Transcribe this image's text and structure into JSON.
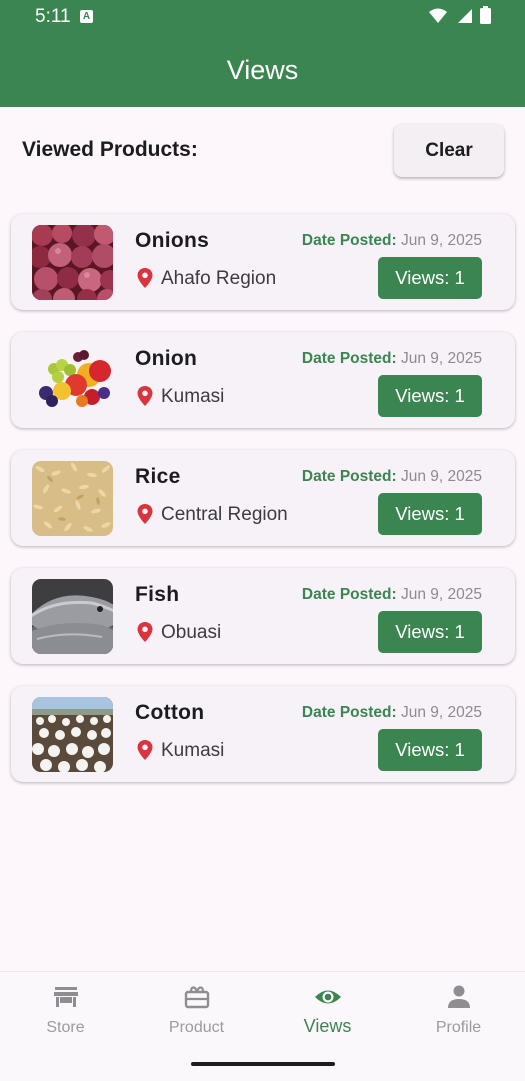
{
  "status_bar": {
    "time": "5:11",
    "notification_badge": "A",
    "icons": [
      "wifi-icon",
      "signal-icon",
      "battery-icon"
    ]
  },
  "app_bar": {
    "title": "Views",
    "color": "#3a8550"
  },
  "section": {
    "label": "Viewed Products:",
    "clear_label": "Clear"
  },
  "date_label": "Date Posted:",
  "products": [
    {
      "name": "Onions",
      "location": "Ahafo Region",
      "date": "Jun 9, 2025",
      "views": "Views: 1",
      "image": "onions"
    },
    {
      "name": "Onion",
      "location": "Kumasi",
      "date": "Jun 9, 2025",
      "views": "Views: 1",
      "image": "fruits"
    },
    {
      "name": "Rice",
      "location": "Central Region",
      "date": "Jun 9, 2025",
      "views": "Views: 1",
      "image": "rice"
    },
    {
      "name": "Fish",
      "location": "Obuasi",
      "date": "Jun 9, 2025",
      "views": "Views: 1",
      "image": "fish"
    },
    {
      "name": "Cotton",
      "location": "Kumasi",
      "date": "Jun 9, 2025",
      "views": "Views: 1",
      "image": "cotton"
    }
  ],
  "bottom_nav": {
    "items": [
      {
        "label": "Store",
        "icon": "store-icon",
        "active": false
      },
      {
        "label": "Product",
        "icon": "product-icon",
        "active": false
      },
      {
        "label": "Views",
        "icon": "eye-icon",
        "active": true
      },
      {
        "label": "Profile",
        "icon": "person-icon",
        "active": false
      }
    ]
  },
  "colors": {
    "accent": "#3a8550",
    "pin": "#d8353f",
    "background": "#fdf7fc"
  }
}
